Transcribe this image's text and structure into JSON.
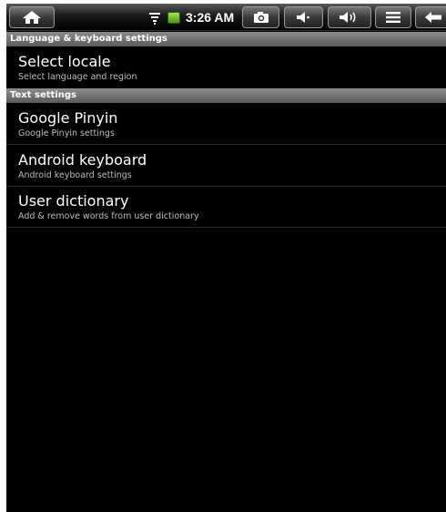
{
  "statusbar": {
    "time": "3:26 AM",
    "icons": [
      "home-icon",
      "wifi-icon",
      "battery-icon",
      "camera-icon",
      "volume-down-icon",
      "volume-up-icon",
      "menu-icon",
      "back-icon"
    ],
    "battery_color": "#4e9a06"
  },
  "sections": [
    {
      "header": "Language & keyboard settings"
    },
    {
      "header": "Text settings"
    }
  ],
  "items": [
    {
      "title": "Select locale",
      "summary": "Select language and region"
    },
    {
      "title": "Google Pinyin",
      "summary": "Google Pinyin settings"
    },
    {
      "title": "Android keyboard",
      "summary": "Android keyboard settings"
    },
    {
      "title": "User dictionary",
      "summary": "Add & remove words from user dictionary"
    }
  ]
}
